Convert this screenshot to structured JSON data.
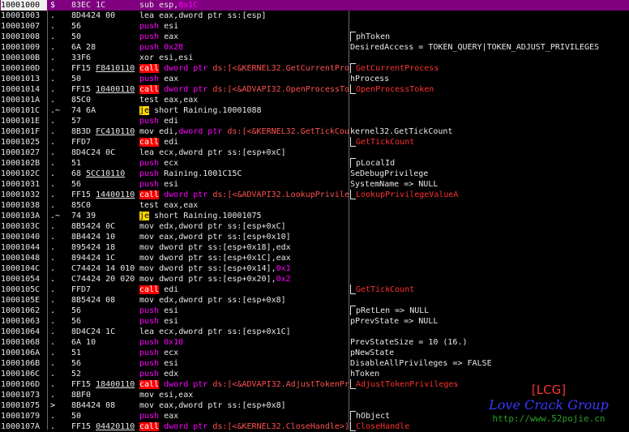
{
  "rows": [
    {
      "addr": "10001000",
      "mark": "$",
      "bytes": "83EC 1C",
      "ins": "sub",
      "ops": [
        {
          "t": "esp,",
          "k": "op"
        },
        {
          "t": "0x1C",
          "k": "num"
        }
      ],
      "cmt": "",
      "sel": true
    },
    {
      "addr": "10001003",
      "mark": ".",
      "bytes": "8D4424 00",
      "ins": "lea",
      "ops": [
        {
          "t": "eax,",
          "k": "op"
        },
        {
          "t": "dword ptr ss:[esp]",
          "k": "op"
        }
      ],
      "cmt": ""
    },
    {
      "addr": "10001007",
      "mark": ".",
      "bytes": "56",
      "ins": "push",
      "ops": [
        {
          "t": "esi",
          "k": "op"
        }
      ],
      "cmt": ""
    },
    {
      "addr": "10001008",
      "mark": ".",
      "bytes": "50",
      "ins": "push",
      "ops": [
        {
          "t": "eax",
          "k": "op"
        }
      ],
      "cmt": "phToken",
      "br": "start"
    },
    {
      "addr": "10001009",
      "mark": ".",
      "bytes": "6A 28",
      "ins": "push",
      "ops": [
        {
          "t": "0x28",
          "k": "num"
        }
      ],
      "cmt": "DesiredAccess = TOKEN_QUERY|TOKEN_ADJUST_PRIVILEGES"
    },
    {
      "addr": "1000100B",
      "mark": ".",
      "bytes": "33F6",
      "ins": "xor",
      "ops": [
        {
          "t": "esi,esi",
          "k": "op"
        }
      ],
      "cmt": ""
    },
    {
      "addr": "1000100D",
      "mark": ".",
      "bytes": "FF15 F8410110",
      "ul": "F8410110",
      "ins": "call",
      "ops": [
        {
          "t": "dword ptr ",
          "k": "kw"
        },
        {
          "t": "ds:[<&KERNEL32.GetCurrentProcess>]",
          "k": "api"
        }
      ],
      "cmt": "GetCurrentProcess",
      "cr": true,
      "br": "both"
    },
    {
      "addr": "10001013",
      "mark": ".",
      "bytes": "50",
      "ins": "push",
      "ops": [
        {
          "t": "eax",
          "k": "op"
        }
      ],
      "cmt": "hProcess"
    },
    {
      "addr": "10001014",
      "mark": ".",
      "bytes": "FF15 10400110",
      "ul": "10400110",
      "ins": "call",
      "ops": [
        {
          "t": "dword ptr ",
          "k": "kw"
        },
        {
          "t": "ds:[<&ADVAPI32.OpenProcessToken>]",
          "k": "api"
        }
      ],
      "cmt": "OpenProcessToken",
      "cr": true,
      "br": "end"
    },
    {
      "addr": "1000101A",
      "mark": ".",
      "bytes": "85C0",
      "ins": "test",
      "ops": [
        {
          "t": "eax,eax",
          "k": "op"
        }
      ],
      "cmt": ""
    },
    {
      "addr": "1000101C",
      "mark": ".~",
      "bytes": "74 6A",
      "ins": "je",
      "ops": [
        {
          "t": "short Raining.10001088",
          "k": "op"
        }
      ],
      "cmt": ""
    },
    {
      "addr": "1000101E",
      "mark": ".",
      "bytes": "57",
      "ins": "push",
      "ops": [
        {
          "t": "edi",
          "k": "op"
        }
      ],
      "cmt": ""
    },
    {
      "addr": "1000101F",
      "mark": ".",
      "bytes": "8B3D FC410110",
      "ul": "FC410110",
      "ins": "mov",
      "ops": [
        {
          "t": "edi,",
          "k": "op"
        },
        {
          "t": "dword ptr ",
          "k": "kw"
        },
        {
          "t": "ds:[<&KERNEL32.GetTickCount>]",
          "k": "api"
        }
      ],
      "cmt": "kernel32.GetTickCount"
    },
    {
      "addr": "10001025",
      "mark": ".",
      "bytes": "FFD7",
      "ins": "call",
      "ops": [
        {
          "t": "edi",
          "k": "op"
        }
      ],
      "cmt": "GetTickCount",
      "cr": true,
      "br": "end"
    },
    {
      "addr": "10001027",
      "mark": ".",
      "bytes": "8D4C24 0C",
      "ins": "lea",
      "ops": [
        {
          "t": "ecx,",
          "k": "op"
        },
        {
          "t": "dword ptr ss:[esp+0xC]",
          "k": "op"
        }
      ],
      "cmt": ""
    },
    {
      "addr": "1000102B",
      "mark": ".",
      "bytes": "51",
      "ins": "push",
      "ops": [
        {
          "t": "ecx",
          "k": "op"
        }
      ],
      "cmt": "pLocalId",
      "br": "start"
    },
    {
      "addr": "1000102C",
      "mark": ".",
      "bytes": "68 5CC10110",
      "ul": "5CC10110",
      "ins": "push",
      "ops": [
        {
          "t": "Raining.1001C15C",
          "k": "op"
        }
      ],
      "cmt": "SeDebugPrivilege"
    },
    {
      "addr": "10001031",
      "mark": ".",
      "bytes": "56",
      "ins": "push",
      "ops": [
        {
          "t": "esi",
          "k": "op"
        }
      ],
      "cmt": "SystemName => NULL"
    },
    {
      "addr": "10001032",
      "mark": ".",
      "bytes": "FF15 14400110",
      "ul": "14400110",
      "ins": "call",
      "ops": [
        {
          "t": "dword ptr ",
          "k": "kw"
        },
        {
          "t": "ds:[<&ADVAPI32.LookupPrivilegeValueA>]",
          "k": "api"
        }
      ],
      "cmt": "LookupPrivilegeValueA",
      "cr": true,
      "br": "end"
    },
    {
      "addr": "10001038",
      "mark": ".",
      "bytes": "85C0",
      "ins": "test",
      "ops": [
        {
          "t": "eax,eax",
          "k": "op"
        }
      ],
      "cmt": ""
    },
    {
      "addr": "1000103A",
      "mark": ".~",
      "bytes": "74 39",
      "ins": "je",
      "ops": [
        {
          "t": "short Raining.10001075",
          "k": "op"
        }
      ],
      "cmt": ""
    },
    {
      "addr": "1000103C",
      "mark": ".",
      "bytes": "8B5424 0C",
      "ins": "mov",
      "ops": [
        {
          "t": "edx,",
          "k": "op"
        },
        {
          "t": "dword ptr ss:[esp+0xC]",
          "k": "op"
        }
      ],
      "cmt": ""
    },
    {
      "addr": "10001040",
      "mark": ".",
      "bytes": "8B4424 10",
      "ins": "mov",
      "ops": [
        {
          "t": "eax,",
          "k": "op"
        },
        {
          "t": "dword ptr ss:[esp+0x10]",
          "k": "op"
        }
      ],
      "cmt": ""
    },
    {
      "addr": "10001044",
      "mark": ".",
      "bytes": "895424 18",
      "ins": "mov",
      "ops": [
        {
          "t": "dword ptr ss:[esp+0x18],edx",
          "k": "op"
        }
      ],
      "cmt": ""
    },
    {
      "addr": "10001048",
      "mark": ".",
      "bytes": "894424 1C",
      "ins": "mov",
      "ops": [
        {
          "t": "dword ptr ss:[esp+0x1C],eax",
          "k": "op"
        }
      ],
      "cmt": ""
    },
    {
      "addr": "1000104C",
      "mark": ".",
      "bytes": "C74424 14 010",
      "ins": "mov",
      "ops": [
        {
          "t": "dword ptr ss:[esp+0x14],",
          "k": "op"
        },
        {
          "t": "0x1",
          "k": "num"
        }
      ],
      "cmt": ""
    },
    {
      "addr": "10001054",
      "mark": ".",
      "bytes": "C74424 20 020",
      "ins": "mov",
      "ops": [
        {
          "t": "dword ptr ss:[esp+0x20],",
          "k": "op"
        },
        {
          "t": "0x2",
          "k": "num"
        }
      ],
      "cmt": ""
    },
    {
      "addr": "1000105C",
      "mark": ".",
      "bytes": "FFD7",
      "ins": "call",
      "ops": [
        {
          "t": "edi",
          "k": "op"
        }
      ],
      "cmt": "GetTickCount",
      "cr": true,
      "br": "end"
    },
    {
      "addr": "1000105E",
      "mark": ".",
      "bytes": "8B5424 08",
      "ins": "mov",
      "ops": [
        {
          "t": "edx,",
          "k": "op"
        },
        {
          "t": "dword ptr ss:[esp+0x8]",
          "k": "op"
        }
      ],
      "cmt": ""
    },
    {
      "addr": "10001062",
      "mark": ".",
      "bytes": "56",
      "ins": "push",
      "ops": [
        {
          "t": "esi",
          "k": "op"
        }
      ],
      "cmt": "pRetLen => NULL",
      "br": "start"
    },
    {
      "addr": "10001063",
      "mark": ".",
      "bytes": "56",
      "ins": "push",
      "ops": [
        {
          "t": "esi",
          "k": "op"
        }
      ],
      "cmt": "pPrevState => NULL"
    },
    {
      "addr": "10001064",
      "mark": ".",
      "bytes": "8D4C24 1C",
      "ins": "lea",
      "ops": [
        {
          "t": "ecx,",
          "k": "op"
        },
        {
          "t": "dword ptr ss:[esp+0x1C]",
          "k": "op"
        }
      ],
      "cmt": ""
    },
    {
      "addr": "10001068",
      "mark": ".",
      "bytes": "6A 10",
      "ins": "push",
      "ops": [
        {
          "t": "0x10",
          "k": "num"
        }
      ],
      "cmt": "PrevStateSize = 10 (16.)"
    },
    {
      "addr": "1000106A",
      "mark": ".",
      "bytes": "51",
      "ins": "push",
      "ops": [
        {
          "t": "ecx",
          "k": "op"
        }
      ],
      "cmt": "pNewState"
    },
    {
      "addr": "1000106B",
      "mark": ".",
      "bytes": "56",
      "ins": "push",
      "ops": [
        {
          "t": "esi",
          "k": "op"
        }
      ],
      "cmt": "DisableAllPrivileges => FALSE"
    },
    {
      "addr": "1000106C",
      "mark": ".",
      "bytes": "52",
      "ins": "push",
      "ops": [
        {
          "t": "edx",
          "k": "op"
        }
      ],
      "cmt": "hToken"
    },
    {
      "addr": "1000106D",
      "mark": ".",
      "bytes": "FF15 18400110",
      "ul": "18400110",
      "ins": "call",
      "ops": [
        {
          "t": "dword ptr ",
          "k": "kw"
        },
        {
          "t": "ds:[<&ADVAPI32.AdjustTokenPrivileges>]",
          "k": "api"
        }
      ],
      "cmt": "AdjustTokenPrivileges",
      "cr": true,
      "br": "end"
    },
    {
      "addr": "10001073",
      "mark": ".",
      "bytes": "8BF0",
      "ins": "mov",
      "ops": [
        {
          "t": "esi,eax",
          "k": "op"
        }
      ],
      "cmt": ""
    },
    {
      "addr": "10001075",
      "mark": ">",
      "bytes": "8B4424 08",
      "ins": "mov",
      "ops": [
        {
          "t": "eax,",
          "k": "op"
        },
        {
          "t": "dword ptr ss:[esp+0x8]",
          "k": "op"
        }
      ],
      "cmt": ""
    },
    {
      "addr": "10001079",
      "mark": ".",
      "bytes": "50",
      "ins": "push",
      "ops": [
        {
          "t": "eax",
          "k": "op"
        }
      ],
      "cmt": "hObject",
      "br": "start"
    },
    {
      "addr": "1000107A",
      "mark": ".",
      "bytes": "FF15 04420110",
      "ul": "04420110",
      "ins": "call",
      "ops": [
        {
          "t": "dword ptr ",
          "k": "kw"
        },
        {
          "t": "ds:[<&KERNEL32.CloseHandle>]",
          "k": "api"
        }
      ],
      "cmt": "CloseHandle",
      "cr": true,
      "br": "end"
    }
  ],
  "watermark": {
    "tag": "[LCG]",
    "name": "Love Crack Group",
    "url": "http://www.52pojie.cn"
  }
}
